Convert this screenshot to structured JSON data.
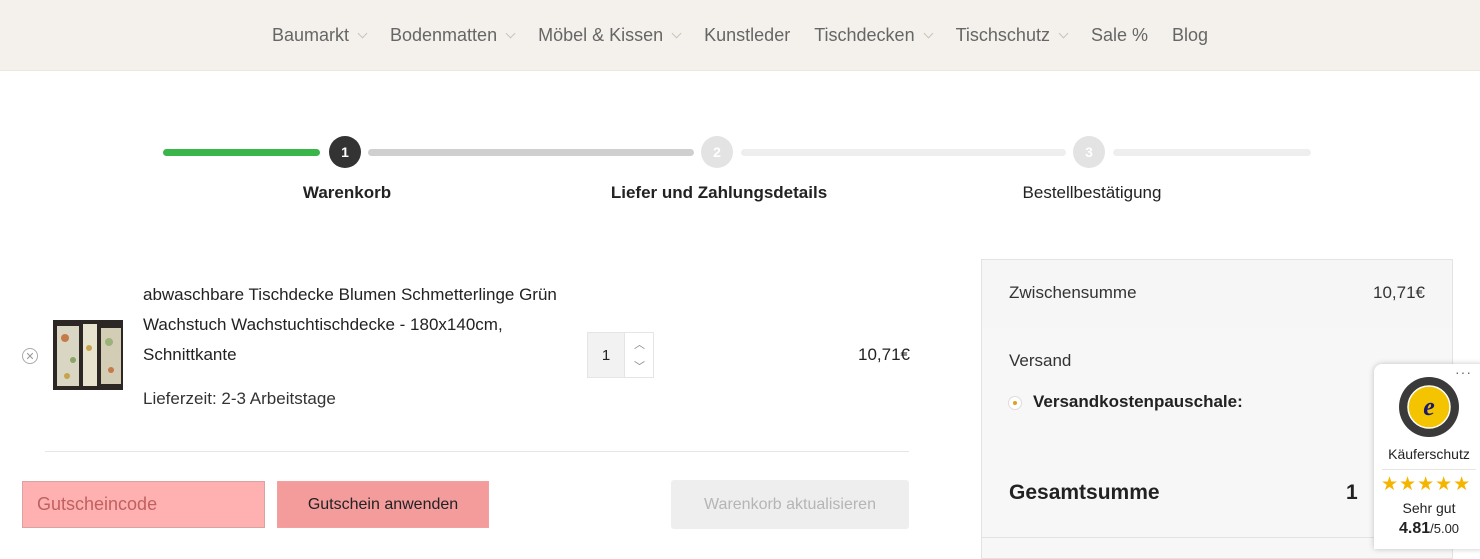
{
  "nav": {
    "items": [
      {
        "label": "Baumarkt",
        "has_dropdown": true
      },
      {
        "label": "Bodenmatten",
        "has_dropdown": true
      },
      {
        "label": "Möbel & Kissen",
        "has_dropdown": true
      },
      {
        "label": "Kunstleder",
        "has_dropdown": false
      },
      {
        "label": "Tischdecken",
        "has_dropdown": true
      },
      {
        "label": "Tischschutz",
        "has_dropdown": true
      },
      {
        "label": "Sale %",
        "has_dropdown": false
      },
      {
        "label": "Blog",
        "has_dropdown": false
      }
    ]
  },
  "stepper": {
    "steps": [
      {
        "number": "1",
        "label": "Warenkorb",
        "state": "active"
      },
      {
        "number": "2",
        "label": "Liefer und Zahlungsdetails",
        "state": "pending"
      },
      {
        "number": "3",
        "label": "Bestellbestätigung",
        "state": "pending"
      }
    ]
  },
  "cart": {
    "item": {
      "title": "abwaschbare Tischdecke Blumen Schmetterlinge Grün Wachstuch Wachstuchtischdecke - 180x140cm, Schnittkante",
      "delivery": "Lieferzeit: 2-3 Arbeitstage",
      "quantity": "1",
      "price": "10,71€"
    },
    "coupon_placeholder": "Gutscheincode",
    "apply_label": "Gutschein anwenden",
    "update_label": "Warenkorb aktualisieren"
  },
  "summary": {
    "subtotal_label": "Zwischensumme",
    "subtotal_value": "10,71€",
    "shipping_label": "Versand",
    "shipping_option": "Versandkostenpauschale:",
    "total_label": "Gesamtsumme",
    "total_value_visible": "1"
  },
  "trusted_shops": {
    "more": "···",
    "label": "Käuferschutz",
    "stars": "★★★★★",
    "rating_text": "Sehr gut",
    "score": "4.81",
    "score_max": "/5.00"
  },
  "colors": {
    "progress_done": "#3ab54a",
    "coupon_highlight": "#ffb1b1",
    "apply_highlight": "#f49c9c",
    "star": "#f4b400"
  }
}
